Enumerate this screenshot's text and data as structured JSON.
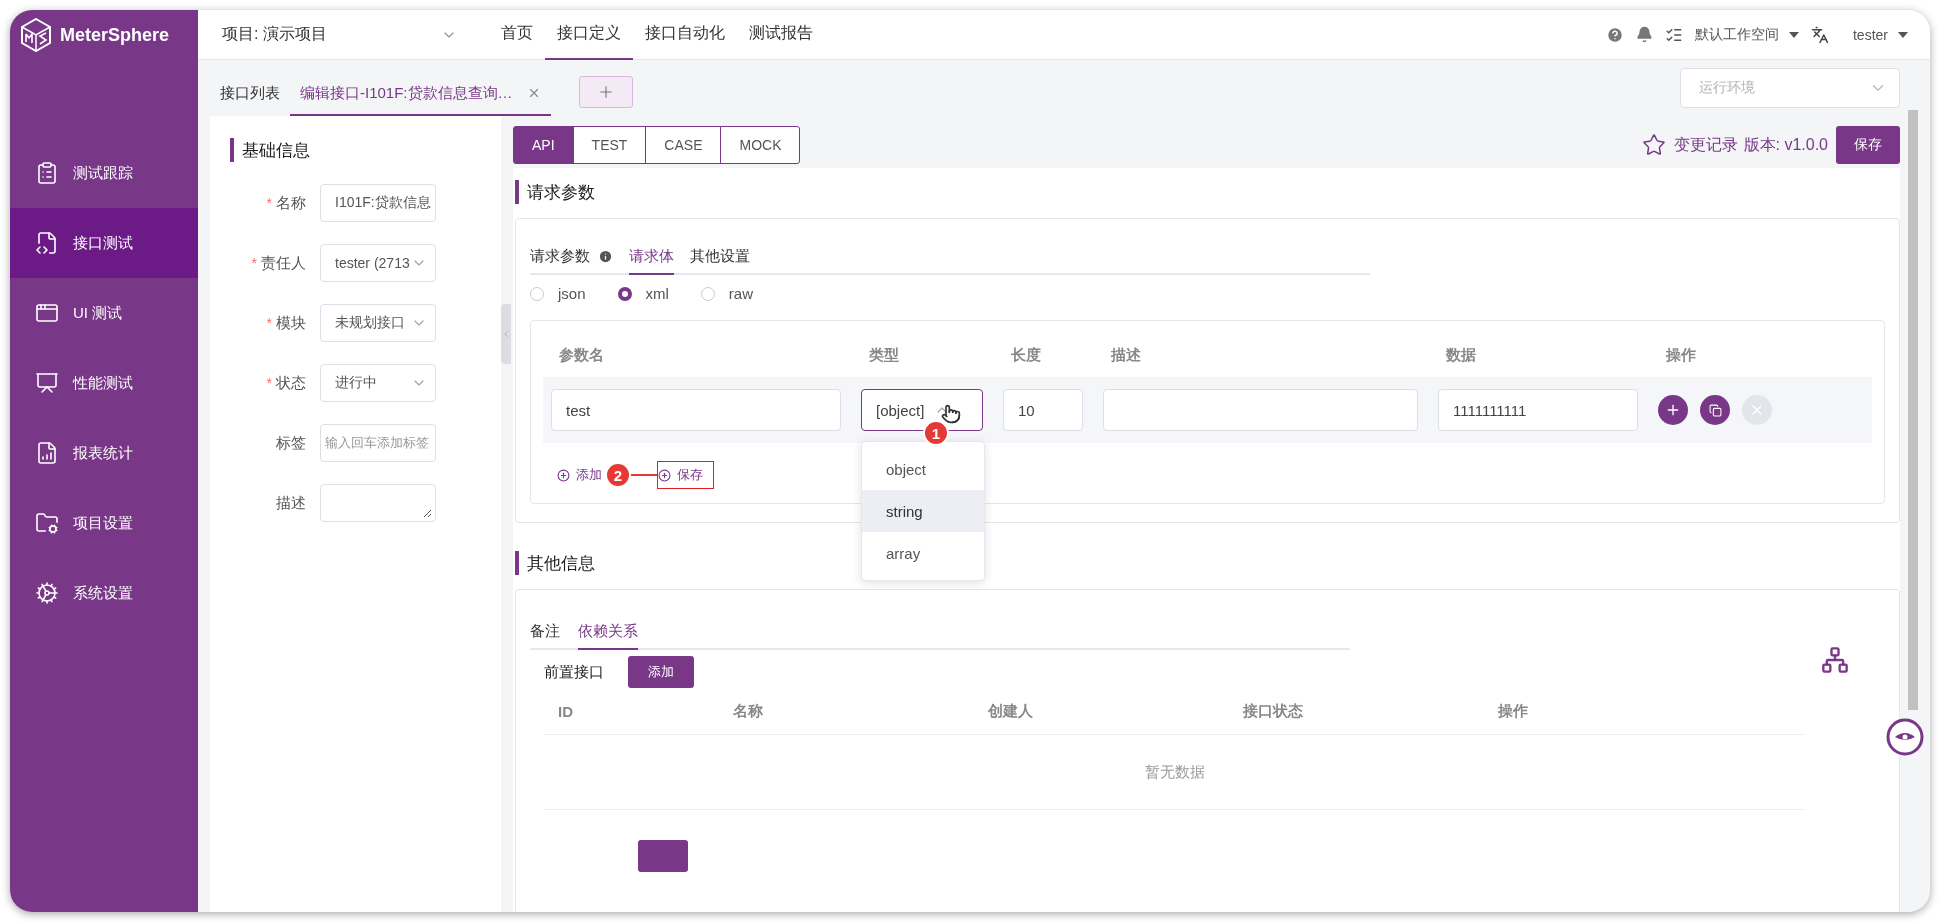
{
  "brand": {
    "name": "MeterSphere"
  },
  "topbar": {
    "project": "项目: 演示项目",
    "nav": [
      {
        "label": "首页",
        "selected": false
      },
      {
        "label": "接口定义",
        "selected": true
      },
      {
        "label": "接口自动化",
        "selected": false
      },
      {
        "label": "测试报告",
        "selected": false
      }
    ],
    "workspace": "默认工作空间",
    "user": "tester"
  },
  "sidebar": {
    "items": [
      {
        "label": "测试跟踪",
        "kind": "track",
        "selected": false
      },
      {
        "label": "接口测试",
        "kind": "api",
        "selected": true
      },
      {
        "label": "UI 测试",
        "kind": "ui",
        "selected": false
      },
      {
        "label": "性能测试",
        "kind": "perf",
        "selected": false
      },
      {
        "label": "报表统计",
        "kind": "report",
        "selected": false
      },
      {
        "label": "项目设置",
        "kind": "project",
        "selected": false
      },
      {
        "label": "系统设置",
        "kind": "system",
        "selected": false
      }
    ]
  },
  "tabs": [
    {
      "label": "接口列表",
      "selected": false,
      "closable": false
    },
    {
      "label": "编辑接口-I101F:贷款信息查询…",
      "selected": true,
      "closable": true
    }
  ],
  "environment": {
    "placeholder": "运行环境"
  },
  "basic_info": {
    "title": "基础信息",
    "required_mark": "*",
    "fields": [
      {
        "label": "名称",
        "required": true,
        "kind": "input",
        "value": "I101F:贷款信息"
      },
      {
        "label": "责任人",
        "required": true,
        "kind": "select",
        "value": "tester (2713"
      },
      {
        "label": "模块",
        "required": true,
        "kind": "select",
        "value": "未规划接口"
      },
      {
        "label": "状态",
        "required": true,
        "kind": "select",
        "value": "进行中"
      },
      {
        "label": "标签",
        "required": false,
        "kind": "input",
        "placeholder": "输入回车添加标签"
      },
      {
        "label": "描述",
        "required": false,
        "kind": "textarea"
      }
    ]
  },
  "mode_tabs": [
    {
      "label": "API",
      "selected": true
    },
    {
      "label": "TEST",
      "selected": false
    },
    {
      "label": "CASE",
      "selected": false
    },
    {
      "label": "MOCK",
      "selected": false
    }
  ],
  "header_actions": {
    "history": "变更记录",
    "version": "版本: v1.0.0",
    "save": "保存"
  },
  "request": {
    "title": "请求参数",
    "tabs": [
      {
        "label": "请求参数",
        "selected": false,
        "info": true
      },
      {
        "label": "请求体",
        "selected": true,
        "info": false
      },
      {
        "label": "其他设置",
        "selected": false,
        "info": false
      }
    ],
    "formats": [
      {
        "label": "json",
        "selected": false
      },
      {
        "label": "xml",
        "selected": true
      },
      {
        "label": "raw",
        "selected": false
      }
    ],
    "columns": [
      "参数名",
      "类型",
      "长度",
      "描述",
      "数据",
      "操作"
    ],
    "rows": [
      {
        "name": "test",
        "type": "[object]",
        "length": "10",
        "data": "1111111111",
        "actions": [
          {
            "kind": "add",
            "disabled": false
          },
          {
            "kind": "copy",
            "disabled": false
          },
          {
            "kind": "remove",
            "disabled": true
          }
        ]
      }
    ],
    "add_link": "添加",
    "save_link": "保存",
    "dropdown": [
      {
        "label": "object",
        "hovered": false
      },
      {
        "label": "string",
        "hovered": true
      },
      {
        "label": "array",
        "hovered": false
      }
    ]
  },
  "annotations": [
    "1",
    "2"
  ],
  "other": {
    "title": "其他信息",
    "tabs": [
      {
        "label": "备注",
        "selected": false
      },
      {
        "label": "依赖关系",
        "selected": true
      }
    ],
    "pre_label": "前置接口",
    "add": "添加",
    "columns": [
      "ID",
      "名称",
      "创建人",
      "接口状态",
      "操作"
    ],
    "empty": "暂无数据"
  }
}
